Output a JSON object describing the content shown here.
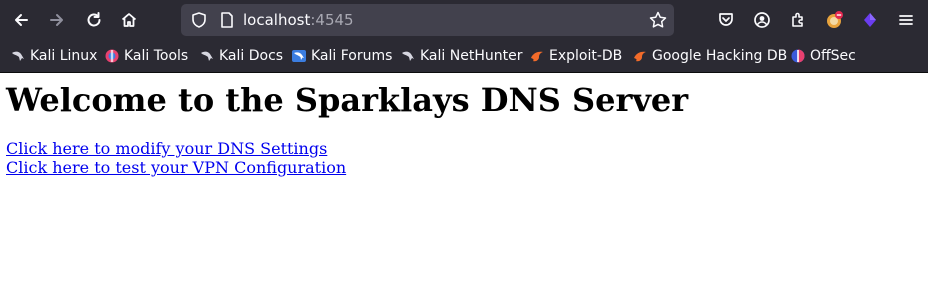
{
  "browser": {
    "url": {
      "host": "localhost",
      "port": ":4545"
    },
    "bookmarks": [
      {
        "label": "Kali Linux",
        "icon": "kali-dragon-icon"
      },
      {
        "label": "Kali Tools",
        "icon": "kali-tools-icon"
      },
      {
        "label": "Kali Docs",
        "icon": "kali-dragon-icon"
      },
      {
        "label": "Kali Forums",
        "icon": "kali-forums-icon"
      },
      {
        "label": "Kali NetHunter",
        "icon": "kali-dragon-icon"
      },
      {
        "label": "Exploit-DB",
        "icon": "exploit-db-icon"
      },
      {
        "label": "Google Hacking DB",
        "icon": "exploit-db-icon"
      },
      {
        "label": "OffSec",
        "icon": "offsec-icon"
      }
    ],
    "colors": {
      "chrome": "#2b2a33",
      "urlbar": "#42414d",
      "link": "#0000ee"
    }
  },
  "page": {
    "heading": "Welcome to the Sparklays DNS Server",
    "links": [
      "Click here to modify your DNS Settings",
      "Click here to test your VPN Configuration"
    ]
  }
}
